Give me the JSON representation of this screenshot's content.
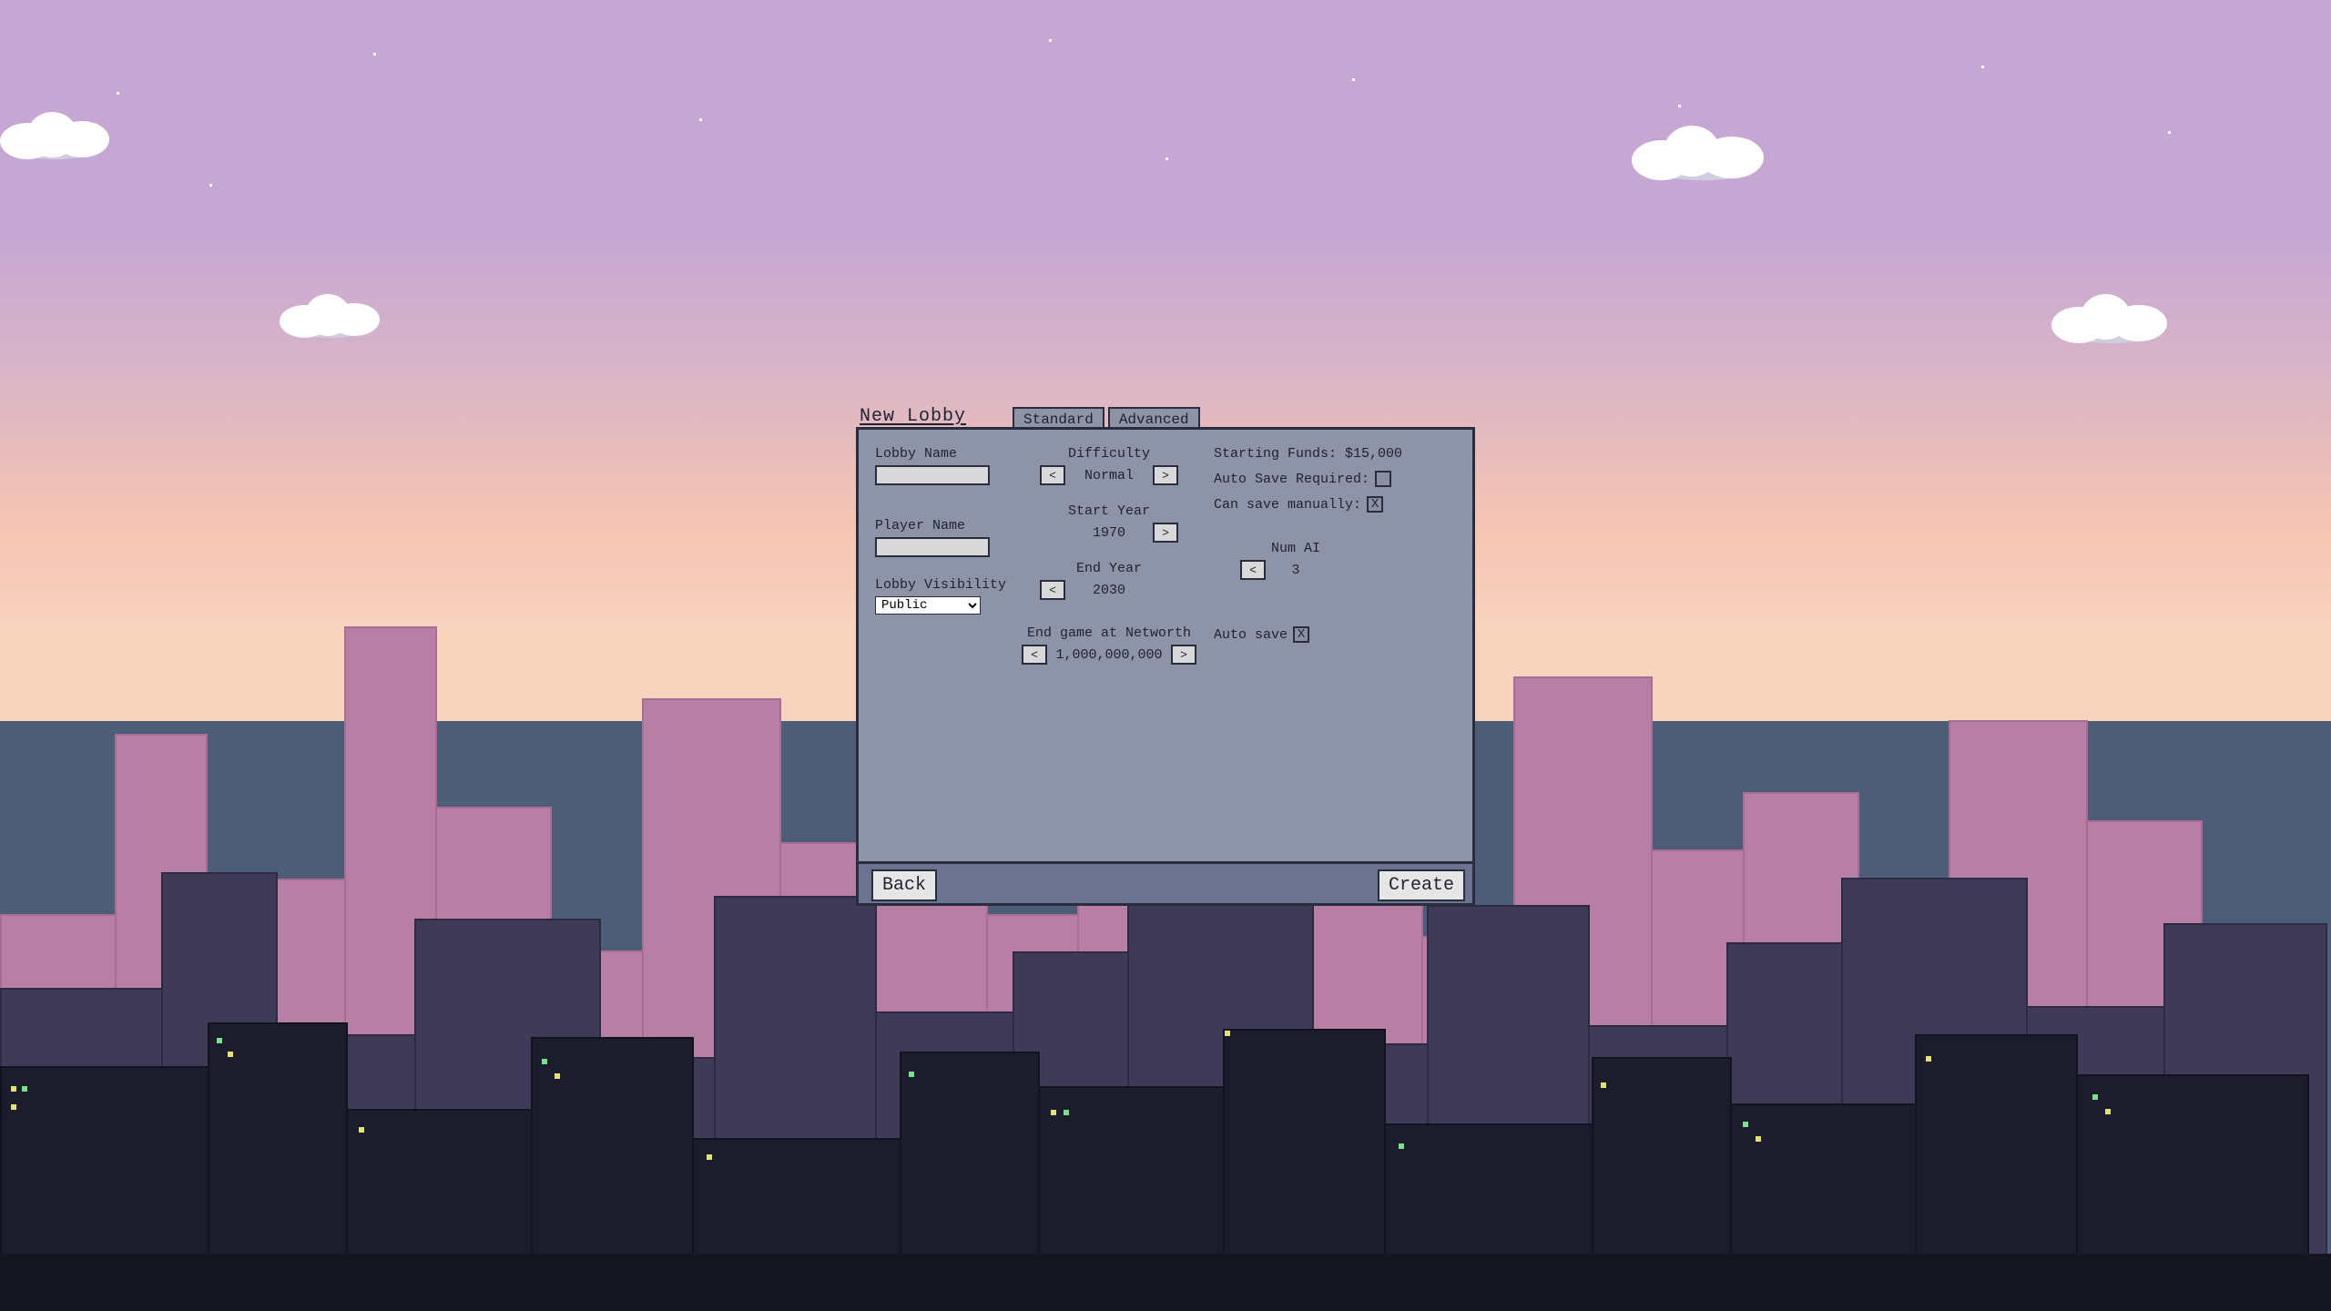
{
  "title": "New Lobby",
  "tabs": {
    "standard": "Standard",
    "advanced": "Advanced"
  },
  "left": {
    "lobby_name_label": "Lobby Name",
    "lobby_name_value": "",
    "player_name_label": "Player Name",
    "player_name_value": "",
    "visibility_label": "Lobby Visibility",
    "visibility_value": "Public"
  },
  "center": {
    "difficulty_label": "Difficulty",
    "difficulty_value": "Normal",
    "start_year_label": "Start Year",
    "start_year_value": "1970",
    "end_year_label": "End Year",
    "end_year_value": "2030",
    "networth_label": "End game at Networth",
    "networth_value": "1,000,000,000"
  },
  "right": {
    "starting_funds_label": "Starting Funds: $15,000",
    "autosave_required_label": "Auto Save Required:",
    "autosave_required_checked": "",
    "can_save_label": "Can save manually:",
    "can_save_checked": "X",
    "num_ai_label": "Num AI",
    "num_ai_value": "3",
    "auto_save_label": "Auto save",
    "auto_save_checked": "X"
  },
  "footer": {
    "back": "Back",
    "create": "Create"
  },
  "glyph": {
    "left": "<",
    "right": ">"
  }
}
